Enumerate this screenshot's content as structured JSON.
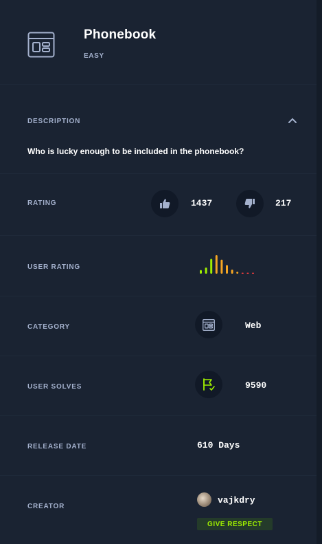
{
  "challenge": {
    "title": "Phonebook",
    "difficulty": "EASY"
  },
  "description": {
    "label": "DESCRIPTION",
    "text": "Who is lucky enough to be included in the phonebook?"
  },
  "rating": {
    "label": "RATING",
    "likes": "1437",
    "dislikes": "217"
  },
  "user_rating": {
    "label": "USER RATING",
    "distribution": [
      0.18,
      0.3,
      0.72,
      0.9,
      0.68,
      0.42,
      0.2,
      0.1,
      0.04,
      0.04,
      0.04
    ],
    "colors": [
      "#9fef00",
      "#9fef00",
      "#9fef00",
      "#f5a623",
      "#f5a623",
      "#f5a623",
      "#f5a623",
      "#f5a623",
      "#ff3e3e",
      "#ff3e3e",
      "#ff3e3e"
    ]
  },
  "category": {
    "label": "CATEGORY",
    "value": "Web",
    "icon": "web-window-icon"
  },
  "user_solves": {
    "label": "USER SOLVES",
    "value": "9590",
    "icon": "flag-icon"
  },
  "release_date": {
    "label": "RELEASE DATE",
    "value": "610 Days"
  },
  "creator": {
    "label": "CREATOR",
    "name": "vajkdry",
    "respect_button": "GIVE RESPECT"
  },
  "colors": {
    "background": "#1a2332",
    "accent_green": "#9fef00",
    "label_gray": "#a4b1cd"
  }
}
